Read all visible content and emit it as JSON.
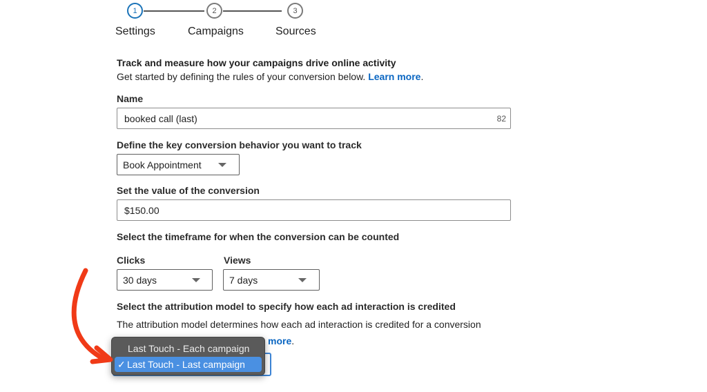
{
  "stepper": {
    "steps": [
      {
        "number": "1",
        "label": "Settings",
        "active": true
      },
      {
        "number": "2",
        "label": "Campaigns",
        "active": false
      },
      {
        "number": "3",
        "label": "Sources",
        "active": false
      }
    ]
  },
  "intro": {
    "heading": "Track and measure how your campaigns drive online activity",
    "subtext": "Get started by defining the rules of your conversion below.",
    "learn_more": "Learn more",
    "period": "."
  },
  "name_field": {
    "label": "Name",
    "value": "booked call (last)",
    "char_counter": "82"
  },
  "behavior_field": {
    "label": "Define the key conversion behavior you want to track",
    "selected": "Book Appointment"
  },
  "value_field": {
    "label": "Set the value of the conversion",
    "value": "$150.00"
  },
  "timeframe": {
    "label": "Select the timeframe for when the conversion can be counted",
    "clicks_label": "Clicks",
    "clicks_value": "30 days",
    "views_label": "Views",
    "views_value": "7 days"
  },
  "attribution": {
    "label": "Select the attribution model to specify how each ad interaction is credited",
    "description": "The attribution model determines how each ad interaction is credited for a conversion",
    "learn_more_tail": "more",
    "period": ".",
    "options": [
      {
        "label": "Last Touch - Each campaign",
        "selected": false
      },
      {
        "label": "Last Touch - Last campaign",
        "selected": true
      }
    ],
    "check_glyph": "✓"
  },
  "annotation": {
    "arrow_color": "#f03a17"
  },
  "colors": {
    "accent": "#0a66c2",
    "active_step": "#1a73b8",
    "menu_bg": "#5a5a5a",
    "menu_selected": "#4a90e2"
  }
}
